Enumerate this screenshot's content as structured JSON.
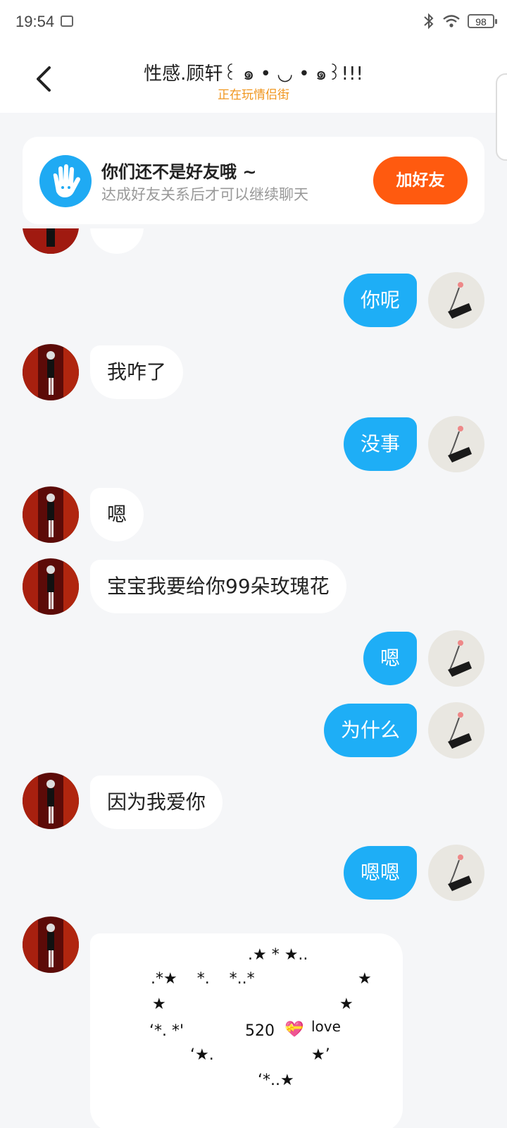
{
  "status_bar": {
    "time": "19:54",
    "battery": "98"
  },
  "header": {
    "title": "性感.顾轩꒰ ๑ • ◡ • ๑꒱!!!",
    "subtitle": "正在玩情侣街"
  },
  "banner": {
    "title": "你们还不是好友哦 ~",
    "subtitle": "达成好友关系后才可以继续聊天",
    "button": "加好友"
  },
  "messages": [
    {
      "side": "out",
      "text": "你呢"
    },
    {
      "side": "in",
      "text": "我咋了"
    },
    {
      "side": "out",
      "text": "没事"
    },
    {
      "side": "in",
      "text": "嗯"
    },
    {
      "side": "in",
      "text": "宝宝我要给你99朵玫瑰花"
    },
    {
      "side": "out",
      "text": "嗯"
    },
    {
      "side": "out",
      "text": "为什么"
    },
    {
      "side": "in",
      "text": "因为我爱你"
    },
    {
      "side": "out",
      "text": "嗯嗯"
    }
  ],
  "art_message": {
    "lines": [
      ".★ * ★..",
      ".*★    *.    *..*",
      "★",
      "★",
      "★",
      "‘*. *'",
      "520",
      "love",
      "‘★.",
      "★’",
      "‘*..★"
    ],
    "heart": "💝"
  },
  "colors": {
    "outgoing_bubble": "#1eaef6",
    "incoming_bubble": "#ffffff",
    "add_button": "#ff5a0f",
    "subtitle": "#f0961e",
    "background": "#f5f6f8"
  }
}
